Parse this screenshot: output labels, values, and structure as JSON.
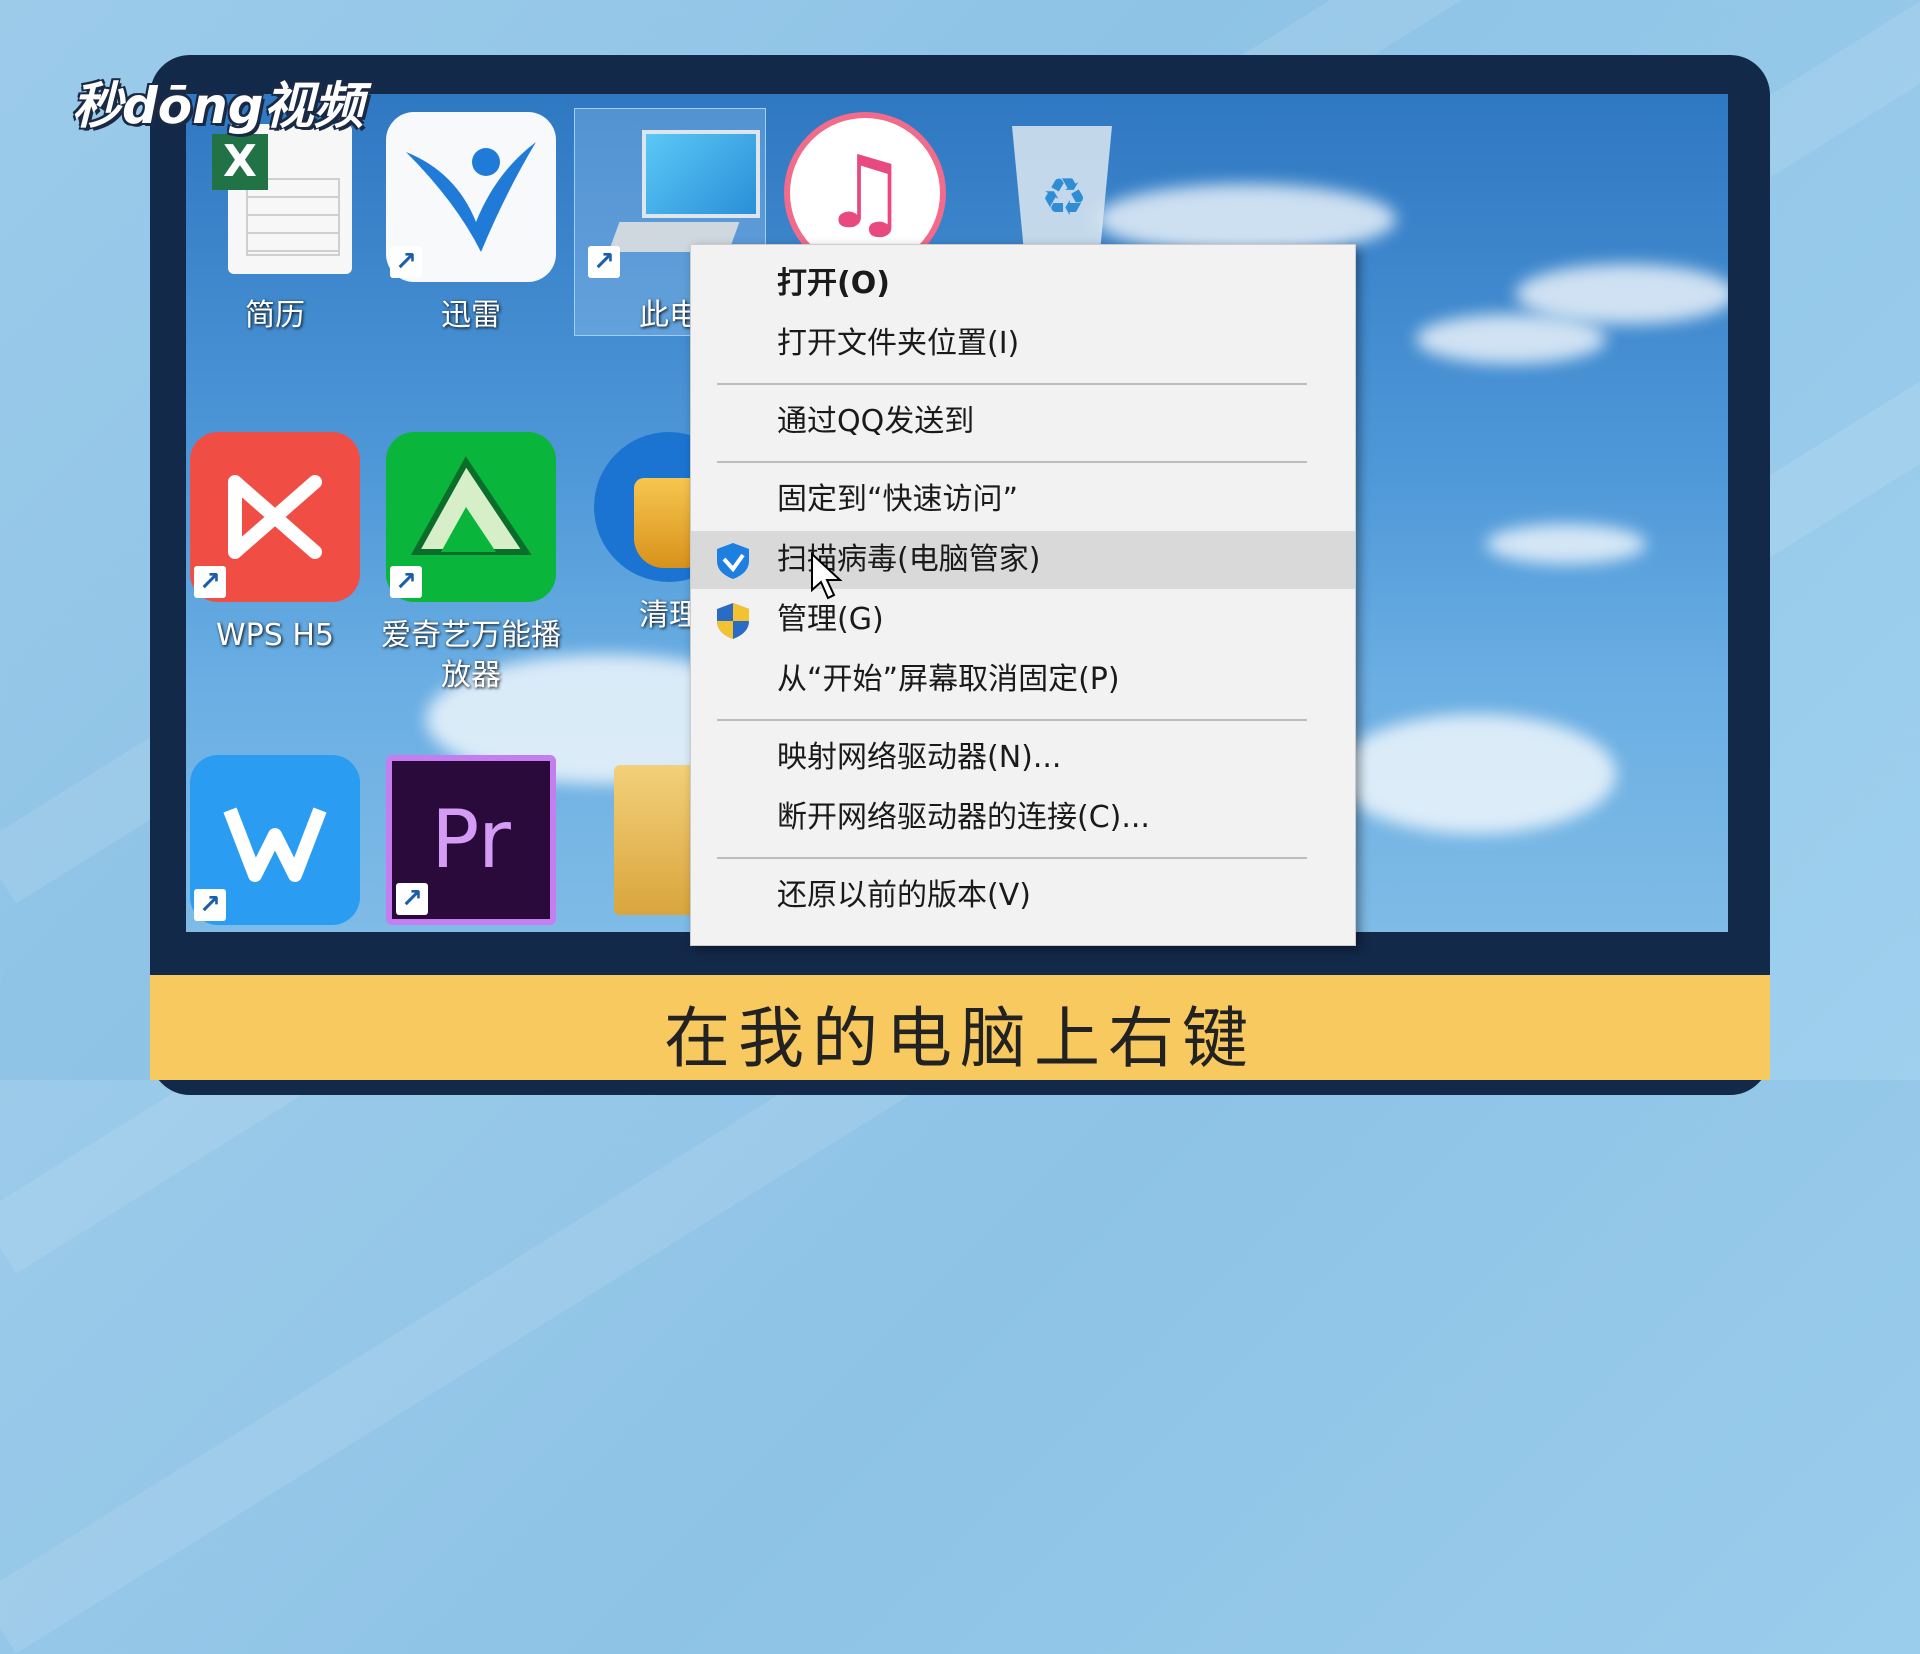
{
  "watermark": {
    "logo_text": "秒dōng视频"
  },
  "desktop_icons": [
    {
      "label": "简历",
      "icon": "excel-file-icon"
    },
    {
      "label": "迅雷",
      "icon": "xunlei-bird-icon"
    },
    {
      "label": "此电",
      "icon": "this-pc-icon"
    },
    {
      "label": "",
      "icon": "itunes-icon"
    },
    {
      "label": "",
      "icon": "recycle-bin-icon"
    },
    {
      "label": "WPS H5",
      "icon": "wps-h5-icon"
    },
    {
      "label": "爱奇艺万能播放器",
      "icon": "iqiyi-player-icon"
    },
    {
      "label": "清理",
      "icon": "cleaner-broom-icon"
    },
    {
      "label": "",
      "icon": "wps-writer-icon"
    },
    {
      "label": "",
      "icon": "premiere-pro-icon"
    },
    {
      "label": "",
      "icon": "folder-icon"
    }
  ],
  "context_menu": {
    "items": [
      {
        "label": "打开(O)",
        "bold": true
      },
      {
        "label": "打开文件夹位置(I)"
      },
      {
        "label": "通过QQ发送到"
      },
      {
        "label": "固定到“快速访问”"
      },
      {
        "label": "扫描病毒(电脑管家)",
        "icon": "tencent-shield-icon",
        "highlighted": true
      },
      {
        "label": "管理(G)",
        "icon": "uac-shield-icon"
      },
      {
        "label": "从“开始”屏幕取消固定(P)"
      },
      {
        "label": "映射网络驱动器(N)..."
      },
      {
        "label": "断开网络驱动器的连接(C)..."
      },
      {
        "label": "还原以前的版本(V)"
      }
    ]
  },
  "icon_texts": {
    "premiere": "Pr",
    "excel": "X"
  },
  "caption": "在我的电脑上右键",
  "colors": {
    "caption_bar": "#f8c95e",
    "frame": "#13294a",
    "menu_bg": "#f2f2f2",
    "highlight": "#d9d9d9"
  }
}
